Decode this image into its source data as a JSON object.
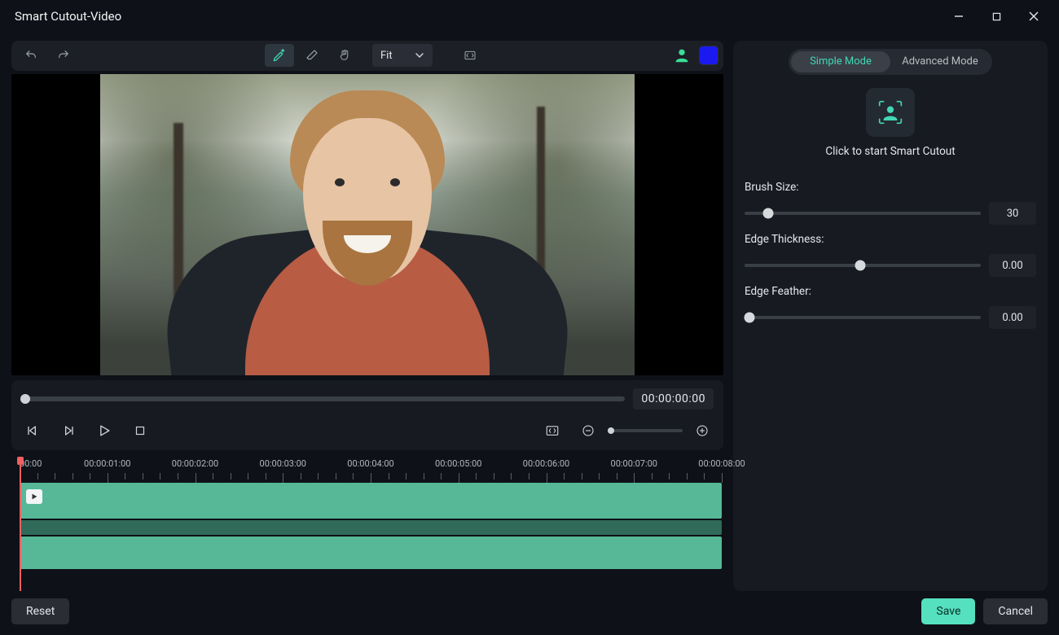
{
  "window": {
    "title": "Smart Cutout-Video"
  },
  "toolbar": {
    "zoom_mode_label": "Fit",
    "tools": {
      "brush": "keep-brush",
      "eraser": "erase-brush",
      "hand": "pan-hand"
    }
  },
  "playback": {
    "timecode": "00:00:00:00"
  },
  "timeline": {
    "labels": [
      "00:00",
      "00:00:01:00",
      "00:00:02:00",
      "00:00:03:00",
      "00:00:04:00",
      "00:00:05:00",
      "00:00:06:00",
      "00:00:07:00",
      "00:00:08:00"
    ]
  },
  "panel": {
    "mode_simple": "Simple Mode",
    "mode_advanced": "Advanced Mode",
    "active_mode": "simple",
    "start_text": "Click to start Smart Cutout",
    "brush_size": {
      "label": "Brush Size:",
      "value": "30",
      "pct": 10
    },
    "edge_thickness": {
      "label": "Edge Thickness:",
      "value": "0.00",
      "pct": 49
    },
    "edge_feather": {
      "label": "Edge Feather:",
      "value": "0.00",
      "pct": 2
    }
  },
  "footer": {
    "reset": "Reset",
    "save": "Save",
    "cancel": "Cancel"
  },
  "colors": {
    "accent": "#43d6b4",
    "swatch": "#1a1af0"
  }
}
